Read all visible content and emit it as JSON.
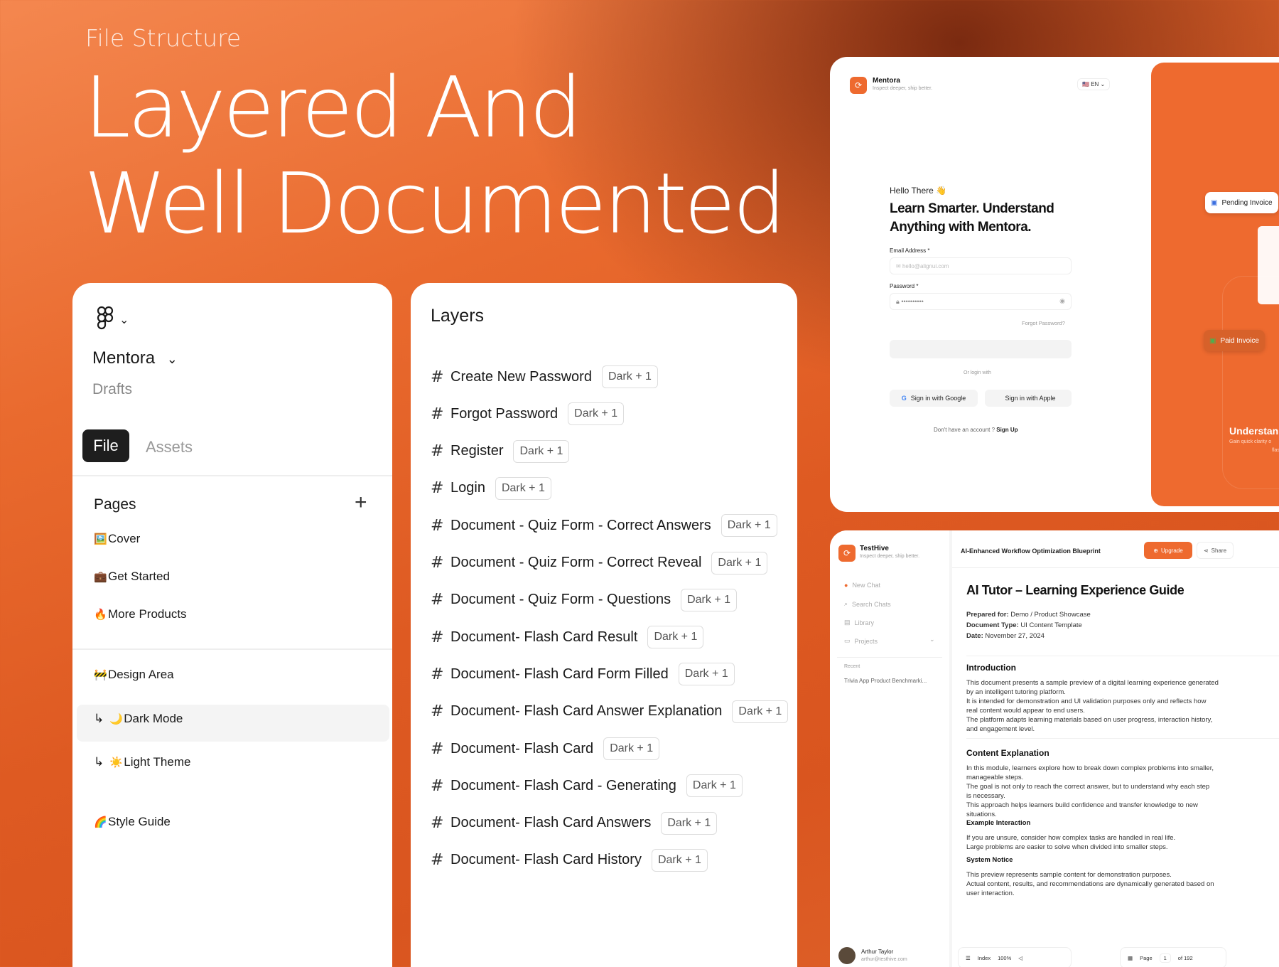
{
  "hero": {
    "eyebrow": "File Structure",
    "title_line1": "Layered And",
    "title_line2": "Well Documented"
  },
  "file_panel": {
    "project_name": "Mentora",
    "project_location": "Drafts",
    "tabs": [
      {
        "label": "File",
        "active": true
      },
      {
        "label": "Assets",
        "active": false
      }
    ],
    "pages_header": "Pages",
    "pages": [
      {
        "emoji": "🖼️",
        "label": "Cover"
      },
      {
        "emoji": "💼",
        "label": "Get Started"
      },
      {
        "emoji": "🔥",
        "label": "More Products"
      },
      {
        "emoji": "🚧",
        "label": "Design Area"
      },
      {
        "emoji": "🌙",
        "label": "Dark Mode",
        "prefix": "↳",
        "selected": true
      },
      {
        "emoji": "☀️",
        "label": "Light Theme",
        "prefix": "↳"
      },
      {
        "emoji": "🌈",
        "label": "Style Guide"
      }
    ]
  },
  "layers_panel": {
    "title": "Layers",
    "items": [
      {
        "name": "Create New Password",
        "badge": "Dark + 1"
      },
      {
        "name": "Forgot Password",
        "badge": "Dark + 1"
      },
      {
        "name": "Register",
        "badge": "Dark + 1"
      },
      {
        "name": "Login",
        "badge": "Dark + 1"
      },
      {
        "name": "Document - Quiz Form - Correct Answers",
        "badge": "Dark + 1"
      },
      {
        "name": "Document - Quiz Form - Correct Reveal",
        "badge": "Dark + 1"
      },
      {
        "name": "Document - Quiz Form - Questions",
        "badge": "Dark + 1"
      },
      {
        "name": "Document- Flash Card Result",
        "badge": "Dark + 1"
      },
      {
        "name": "Document- Flash Card Form Filled",
        "badge": "Dark + 1"
      },
      {
        "name": "Document- Flash Card Answer Explanation",
        "badge": "Dark + 1"
      },
      {
        "name": "Document- Flash Card",
        "badge": "Dark + 1"
      },
      {
        "name": "Document- Flash Card - Generating",
        "badge": "Dark + 1"
      },
      {
        "name": "Document- Flash Card Answers",
        "badge": "Dark + 1"
      },
      {
        "name": "Document- Flash Card History",
        "badge": "Dark + 1"
      }
    ]
  },
  "login_preview": {
    "brand": "Mentora",
    "tagline": "Inspect deeper, ship better.",
    "lang": "EN",
    "greeting": "Hello There 👋",
    "heading_line1": "Learn Smarter. Understand",
    "heading_line2": "Anything with Mentora.",
    "email_label": "Email Address *",
    "email_placeholder": "hello@alignui.com",
    "password_label": "Password *",
    "password_value": "••••••••••",
    "forgot": "Forgot Password?",
    "or_login": "Or login with",
    "google_btn": "Sign in with Google",
    "apple_btn": "Sign in with Apple",
    "signup_prompt": "Don't have an account ?",
    "signup_link": "Sign Up",
    "float_pending": "Pending Invoice",
    "float_paid": "Paid Invoice",
    "side_heading": "Understan",
    "side_sub1": "Gain quick clarity o",
    "side_sub2": "flashc"
  },
  "doc_preview": {
    "brand": "TestHive",
    "tagline": "Inspect deeper, ship better.",
    "nav": [
      {
        "icon": "plus-circle-icon",
        "label": "New Chat"
      },
      {
        "icon": "search-icon",
        "label": "Search Chats"
      },
      {
        "icon": "library-icon",
        "label": "Library"
      },
      {
        "icon": "folder-icon",
        "label": "Projects"
      }
    ],
    "recent_label": "Recent",
    "recent_item": "Trivia App Product Benchmarki...",
    "user_name": "Arthur Taylor",
    "user_email": "arthur@testhive.com",
    "doc_title_bar": "AI-Enhanced Workflow Optimization Blueprint",
    "upgrade_btn": "Upgrade",
    "share_btn": "Share",
    "doc_heading": "AI Tutor – Learning Experience Guide",
    "prepared_label": "Prepared for:",
    "prepared_value": "Demo / Product Showcase",
    "type_label": "Document Type:",
    "type_value": "UI Content Template",
    "date_label": "Date:",
    "date_value": "November 27, 2024",
    "intro_heading": "Introduction",
    "intro_lines": [
      "This document presents a sample preview of a digital learning experience generated",
      "by an intelligent tutoring platform.",
      "It is intended for demonstration and UI validation purposes only and reflects how",
      "real content would appear to end users.",
      "The platform adapts learning materials based on user progress, interaction history,",
      "and engagement level."
    ],
    "content_heading": "Content Explanation",
    "content_lines": [
      "In this module, learners explore how to break down complex problems into smaller,",
      "manageable steps.",
      "The goal is not only to reach the correct answer, but to understand why each step",
      "is necessary.",
      "This approach helps learners build confidence and transfer knowledge to new",
      "situations."
    ],
    "example_heading": "Example Interaction",
    "example_lines": [
      "If you are unsure, consider how complex tasks are handled in real life.",
      "Large problems are easier to solve when divided into smaller steps."
    ],
    "notice_heading": "System Notice",
    "notice_lines": [
      "This preview represents sample content for demonstration purposes.",
      " Actual content, results, and recommendations are dynamically generated based on",
      "user interaction."
    ],
    "footer_index": "Index",
    "footer_zoom": "100%",
    "footer_page_label": "Page",
    "footer_page": "1",
    "footer_of": "of 192"
  },
  "colors": {
    "accent": "#ee6a2f",
    "dark_tab": "#1e1e1e"
  }
}
